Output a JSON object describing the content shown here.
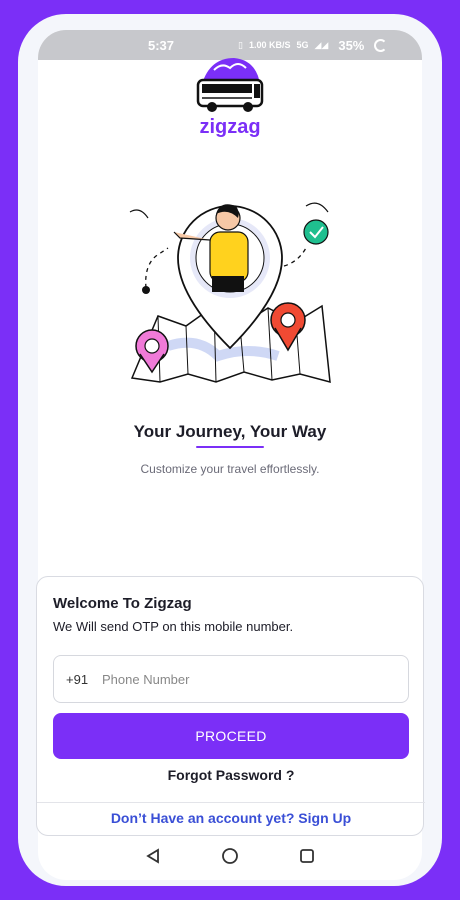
{
  "statusbar": {
    "time": "5:37",
    "speed": "1.00 KB/S",
    "network": "5G",
    "battery": "35%"
  },
  "brand": {
    "name": "zigzag",
    "color": "#7b2ff7"
  },
  "hero": {
    "title": "Your Journey, Your Way",
    "subtitle": "Customize your travel effortlessly."
  },
  "login": {
    "welcome": "Welcome To Zigzag",
    "otp_text": "We Will send OTP on this mobile number.",
    "country_code": "+91",
    "phone_placeholder": "Phone Number",
    "proceed_label": "PROCEED",
    "forgot_label": "Forgot Password ?",
    "signup_label": "Don’t Have an account yet? Sign Up"
  },
  "navbar": {
    "back_icon": "back-triangle-icon",
    "home_icon": "home-circle-icon",
    "recents_icon": "recents-square-icon"
  }
}
